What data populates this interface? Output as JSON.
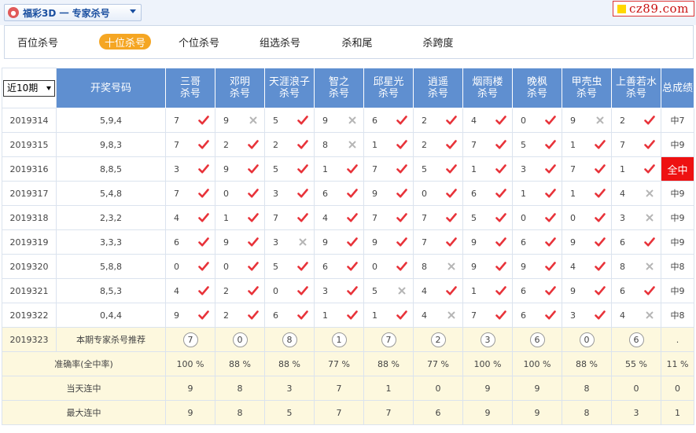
{
  "header": {
    "title": "福彩3D 一 专家杀号",
    "logo_icon": "fucai-logo-icon",
    "brand": "cz89.com",
    "brand_color": "#c81010"
  },
  "tabs": [
    {
      "label": "百位杀号",
      "active": false
    },
    {
      "label": "十位杀号",
      "active": true
    },
    {
      "label": "个位杀号",
      "active": false
    },
    {
      "label": "组选杀号",
      "active": false
    },
    {
      "label": "杀和尾",
      "active": false
    },
    {
      "label": "杀跨度",
      "active": false
    }
  ],
  "table": {
    "period_select": "近10期",
    "col_number": "开奖号码",
    "col_total": "总成绩",
    "experts": [
      {
        "name": "三哥",
        "sub": "杀号"
      },
      {
        "name": "邓明",
        "sub": "杀号"
      },
      {
        "name": "天涯浪子",
        "sub": "杀号"
      },
      {
        "name": "智之",
        "sub": "杀号"
      },
      {
        "name": "邱星光",
        "sub": "杀号"
      },
      {
        "name": "逍遥",
        "sub": "杀号"
      },
      {
        "name": "烟雨楼",
        "sub": "杀号"
      },
      {
        "name": "晚枫",
        "sub": "杀号"
      },
      {
        "name": "甲壳虫",
        "sub": "杀号"
      },
      {
        "name": "上善若水",
        "sub": "杀号"
      }
    ],
    "rows": [
      {
        "issue": "2019314",
        "number": "5,9,4",
        "cells": [
          {
            "n": "7",
            "ok": true
          },
          {
            "n": "9",
            "ok": false
          },
          {
            "n": "5",
            "ok": true
          },
          {
            "n": "9",
            "ok": false
          },
          {
            "n": "6",
            "ok": true
          },
          {
            "n": "2",
            "ok": true
          },
          {
            "n": "4",
            "ok": true
          },
          {
            "n": "0",
            "ok": true
          },
          {
            "n": "9",
            "ok": false
          },
          {
            "n": "2",
            "ok": true
          }
        ],
        "total": "中7",
        "full": false
      },
      {
        "issue": "2019315",
        "number": "9,8,3",
        "cells": [
          {
            "n": "7",
            "ok": true
          },
          {
            "n": "2",
            "ok": true
          },
          {
            "n": "2",
            "ok": true
          },
          {
            "n": "8",
            "ok": false
          },
          {
            "n": "1",
            "ok": true
          },
          {
            "n": "2",
            "ok": true
          },
          {
            "n": "7",
            "ok": true
          },
          {
            "n": "5",
            "ok": true
          },
          {
            "n": "1",
            "ok": true
          },
          {
            "n": "7",
            "ok": true
          }
        ],
        "total": "中9",
        "full": false
      },
      {
        "issue": "2019316",
        "number": "8,8,5",
        "cells": [
          {
            "n": "3",
            "ok": true
          },
          {
            "n": "9",
            "ok": true
          },
          {
            "n": "5",
            "ok": true
          },
          {
            "n": "1",
            "ok": true
          },
          {
            "n": "7",
            "ok": true
          },
          {
            "n": "5",
            "ok": true
          },
          {
            "n": "1",
            "ok": true
          },
          {
            "n": "3",
            "ok": true
          },
          {
            "n": "7",
            "ok": true
          },
          {
            "n": "1",
            "ok": true
          }
        ],
        "total": "全中",
        "full": true
      },
      {
        "issue": "2019317",
        "number": "5,4,8",
        "cells": [
          {
            "n": "7",
            "ok": true
          },
          {
            "n": "0",
            "ok": true
          },
          {
            "n": "3",
            "ok": true
          },
          {
            "n": "6",
            "ok": true
          },
          {
            "n": "9",
            "ok": true
          },
          {
            "n": "0",
            "ok": true
          },
          {
            "n": "6",
            "ok": true
          },
          {
            "n": "1",
            "ok": true
          },
          {
            "n": "1",
            "ok": true
          },
          {
            "n": "4",
            "ok": false
          }
        ],
        "total": "中9",
        "full": false
      },
      {
        "issue": "2019318",
        "number": "2,3,2",
        "cells": [
          {
            "n": "4",
            "ok": true
          },
          {
            "n": "1",
            "ok": true
          },
          {
            "n": "7",
            "ok": true
          },
          {
            "n": "4",
            "ok": true
          },
          {
            "n": "7",
            "ok": true
          },
          {
            "n": "7",
            "ok": true
          },
          {
            "n": "5",
            "ok": true
          },
          {
            "n": "0",
            "ok": true
          },
          {
            "n": "0",
            "ok": true
          },
          {
            "n": "3",
            "ok": false
          }
        ],
        "total": "中9",
        "full": false
      },
      {
        "issue": "2019319",
        "number": "3,3,3",
        "cells": [
          {
            "n": "6",
            "ok": true
          },
          {
            "n": "9",
            "ok": true
          },
          {
            "n": "3",
            "ok": false
          },
          {
            "n": "9",
            "ok": true
          },
          {
            "n": "9",
            "ok": true
          },
          {
            "n": "7",
            "ok": true
          },
          {
            "n": "9",
            "ok": true
          },
          {
            "n": "6",
            "ok": true
          },
          {
            "n": "9",
            "ok": true
          },
          {
            "n": "6",
            "ok": true
          }
        ],
        "total": "中9",
        "full": false
      },
      {
        "issue": "2019320",
        "number": "5,8,8",
        "cells": [
          {
            "n": "0",
            "ok": true
          },
          {
            "n": "0",
            "ok": true
          },
          {
            "n": "5",
            "ok": true
          },
          {
            "n": "6",
            "ok": true
          },
          {
            "n": "0",
            "ok": true
          },
          {
            "n": "8",
            "ok": false
          },
          {
            "n": "9",
            "ok": true
          },
          {
            "n": "9",
            "ok": true
          },
          {
            "n": "4",
            "ok": true
          },
          {
            "n": "8",
            "ok": false
          }
        ],
        "total": "中8",
        "full": false
      },
      {
        "issue": "2019321",
        "number": "8,5,3",
        "cells": [
          {
            "n": "4",
            "ok": true
          },
          {
            "n": "2",
            "ok": true
          },
          {
            "n": "0",
            "ok": true
          },
          {
            "n": "3",
            "ok": true
          },
          {
            "n": "5",
            "ok": false
          },
          {
            "n": "4",
            "ok": true
          },
          {
            "n": "1",
            "ok": true
          },
          {
            "n": "6",
            "ok": true
          },
          {
            "n": "9",
            "ok": true
          },
          {
            "n": "6",
            "ok": true
          }
        ],
        "total": "中9",
        "full": false
      },
      {
        "issue": "2019322",
        "number": "0,4,4",
        "cells": [
          {
            "n": "9",
            "ok": true
          },
          {
            "n": "2",
            "ok": true
          },
          {
            "n": "6",
            "ok": true
          },
          {
            "n": "1",
            "ok": true
          },
          {
            "n": "1",
            "ok": true
          },
          {
            "n": "4",
            "ok": false
          },
          {
            "n": "7",
            "ok": true
          },
          {
            "n": "6",
            "ok": true
          },
          {
            "n": "3",
            "ok": true
          },
          {
            "n": "4",
            "ok": false
          }
        ],
        "total": "中8",
        "full": false
      }
    ],
    "recommend": {
      "issue": "2019323",
      "label": "本期专家杀号推荐",
      "picks": [
        "7",
        "0",
        "8",
        "1",
        "7",
        "2",
        "3",
        "6",
        "0",
        "6"
      ],
      "total": "."
    },
    "accuracy": {
      "label": "准确率(全中率)",
      "values": [
        "100 %",
        "88 %",
        "88 %",
        "77 %",
        "88 %",
        "77 %",
        "100 %",
        "100 %",
        "88 %",
        "55 %"
      ],
      "total": "11 %"
    },
    "streak_today": {
      "label": "当天连中",
      "values": [
        "9",
        "8",
        "3",
        "7",
        "1",
        "0",
        "9",
        "9",
        "8",
        "0"
      ],
      "total": "0"
    },
    "streak_max": {
      "label": "最大连中",
      "values": [
        "9",
        "8",
        "5",
        "7",
        "7",
        "6",
        "9",
        "9",
        "8",
        "3"
      ],
      "total": "1"
    }
  },
  "colors": {
    "header_blue": "#5f8fd0",
    "hit_red": "#e8333a",
    "miss_gray": "#b5b5b5",
    "full_red": "#ee1111",
    "tab_orange": "#f5a623",
    "recommend_bg": "#fdf8de"
  },
  "icons": {
    "hit": "check-icon",
    "miss": "cross-icon"
  }
}
